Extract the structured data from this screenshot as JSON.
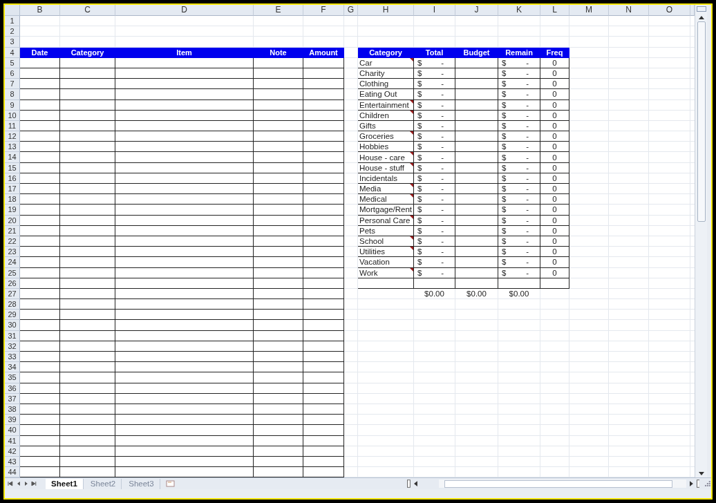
{
  "column_headers": [
    "B",
    "C",
    "D",
    "E",
    "F",
    "G",
    "H",
    "I",
    "J",
    "K",
    "L",
    "M",
    "N",
    "O"
  ],
  "row_numbers": [
    "1",
    "2",
    "3",
    "4",
    "5",
    "6",
    "7",
    "8",
    "9",
    "10",
    "11",
    "12",
    "13",
    "14",
    "15",
    "16",
    "17",
    "18",
    "19",
    "20",
    "21",
    "22",
    "23",
    "24",
    "25",
    "26",
    "27",
    "28",
    "29",
    "30",
    "31",
    "32",
    "33",
    "34",
    "35",
    "36",
    "37",
    "38",
    "39",
    "40",
    "41",
    "42",
    "43",
    "44"
  ],
  "expense_log": {
    "columns": [
      "Date",
      "Category",
      "Item",
      "Note",
      "Amount"
    ]
  },
  "summary": {
    "columns": [
      "Category",
      "Total",
      "Budget",
      "Remain",
      "Freq"
    ],
    "rows": [
      {
        "category": "Car",
        "total_symbol": "$",
        "total": "-",
        "remain_symbol": "$",
        "remain": "-",
        "freq": "0",
        "has_comment": true
      },
      {
        "category": "Charity",
        "total_symbol": "$",
        "total": "-",
        "remain_symbol": "$",
        "remain": "-",
        "freq": "0",
        "has_comment": false
      },
      {
        "category": "Clothing",
        "total_symbol": "$",
        "total": "-",
        "remain_symbol": "$",
        "remain": "-",
        "freq": "0",
        "has_comment": false
      },
      {
        "category": "Eating Out",
        "total_symbol": "$",
        "total": "-",
        "remain_symbol": "$",
        "remain": "-",
        "freq": "0",
        "has_comment": false
      },
      {
        "category": "Entertainment",
        "total_symbol": "$",
        "total": "-",
        "remain_symbol": "$",
        "remain": "-",
        "freq": "0",
        "has_comment": true
      },
      {
        "category": "Children",
        "total_symbol": "$",
        "total": "-",
        "remain_symbol": "$",
        "remain": "-",
        "freq": "0",
        "has_comment": true
      },
      {
        "category": "Gifts",
        "total_symbol": "$",
        "total": "-",
        "remain_symbol": "$",
        "remain": "-",
        "freq": "0",
        "has_comment": false
      },
      {
        "category": "Groceries",
        "total_symbol": "$",
        "total": "-",
        "remain_symbol": "$",
        "remain": "-",
        "freq": "0",
        "has_comment": true
      },
      {
        "category": "Hobbies",
        "total_symbol": "$",
        "total": "-",
        "remain_symbol": "$",
        "remain": "-",
        "freq": "0",
        "has_comment": false
      },
      {
        "category": "House - care",
        "total_symbol": "$",
        "total": "-",
        "remain_symbol": "$",
        "remain": "-",
        "freq": "0",
        "has_comment": true
      },
      {
        "category": "House - stuff",
        "total_symbol": "$",
        "total": "-",
        "remain_symbol": "$",
        "remain": "-",
        "freq": "0",
        "has_comment": true
      },
      {
        "category": "Incidentals",
        "total_symbol": "$",
        "total": "-",
        "remain_symbol": "$",
        "remain": "-",
        "freq": "0",
        "has_comment": false
      },
      {
        "category": "Media",
        "total_symbol": "$",
        "total": "-",
        "remain_symbol": "$",
        "remain": "-",
        "freq": "0",
        "has_comment": true
      },
      {
        "category": "Medical",
        "total_symbol": "$",
        "total": "-",
        "remain_symbol": "$",
        "remain": "-",
        "freq": "0",
        "has_comment": true
      },
      {
        "category": "Mortgage/Rent",
        "total_symbol": "$",
        "total": "-",
        "remain_symbol": "$",
        "remain": "-",
        "freq": "0",
        "has_comment": false
      },
      {
        "category": "Personal Care",
        "total_symbol": "$",
        "total": "-",
        "remain_symbol": "$",
        "remain": "-",
        "freq": "0",
        "has_comment": true
      },
      {
        "category": "Pets",
        "total_symbol": "$",
        "total": "-",
        "remain_symbol": "$",
        "remain": "-",
        "freq": "0",
        "has_comment": false
      },
      {
        "category": "School",
        "total_symbol": "$",
        "total": "-",
        "remain_symbol": "$",
        "remain": "-",
        "freq": "0",
        "has_comment": true
      },
      {
        "category": "Utilities",
        "total_symbol": "$",
        "total": "-",
        "remain_symbol": "$",
        "remain": "-",
        "freq": "0",
        "has_comment": true
      },
      {
        "category": "Vacation",
        "total_symbol": "$",
        "total": "-",
        "remain_symbol": "$",
        "remain": "-",
        "freq": "0",
        "has_comment": false
      },
      {
        "category": "Work",
        "total_symbol": "$",
        "total": "-",
        "remain_symbol": "$",
        "remain": "-",
        "freq": "0",
        "has_comment": true
      }
    ],
    "totals": [
      "$0.00",
      "$0.00",
      "$0.00"
    ]
  },
  "sheet_tabs": [
    {
      "label": "Sheet1",
      "selected": true
    },
    {
      "label": "Sheet2",
      "selected": false
    },
    {
      "label": "Sheet3",
      "selected": false
    }
  ]
}
